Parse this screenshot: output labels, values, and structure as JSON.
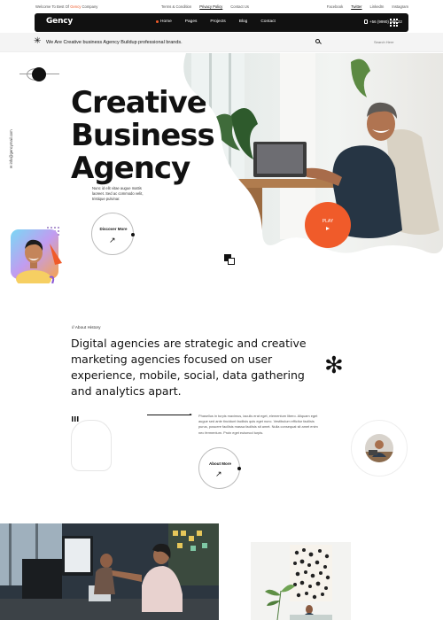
{
  "topbar": {
    "welcome_prefix": "Welcome To Best Of",
    "welcome_brand": "Gency",
    "welcome_suffix": "Company",
    "links": [
      "Terms & Condition",
      "Privacy Policy",
      "Contact Us"
    ],
    "social": [
      "Facebook",
      "Twitter",
      "LinkedIn",
      "Instagram"
    ]
  },
  "nav": {
    "logo": "Gency",
    "items": [
      "Home",
      "Pages",
      "Projects",
      "Blog",
      "Contact"
    ],
    "phone": "+56 (9990) 666 22"
  },
  "announce": {
    "text": "We Are Creative business Agency Buildup professional brands.",
    "search_placeholder": "Search Here"
  },
  "side": {
    "email": "✉ info@gencymail.com"
  },
  "hero": {
    "title_lines": [
      "Creative",
      "Business",
      "Agency"
    ],
    "description": "Nunc id elit vitae augue mattis laoreet. Sed ac commodo velit, tristique pulvinar.",
    "discover_label": "Discover More",
    "play_label": "PLAY"
  },
  "about": {
    "kicker": "// About History",
    "heading": "Digital agencies are strategic and creative marketing agencies focused on user experience, mobile, social, data gathering and analytics apart.",
    "body": "Phasellus in turpis maximus, iaculis erat eget, elementum libero. Aliquam eget augue sed ante tincidunt facilisis quis eget nunc. Vestibulum efficitur facilisis purus, posuere facilisis massa facilisis sit amet. Nulla consequat sit amet enim nec fermentum. Proin eget euismod turpis.",
    "button_label": "About More"
  },
  "colors": {
    "accent": "#f05b2a",
    "dark": "#111111"
  }
}
